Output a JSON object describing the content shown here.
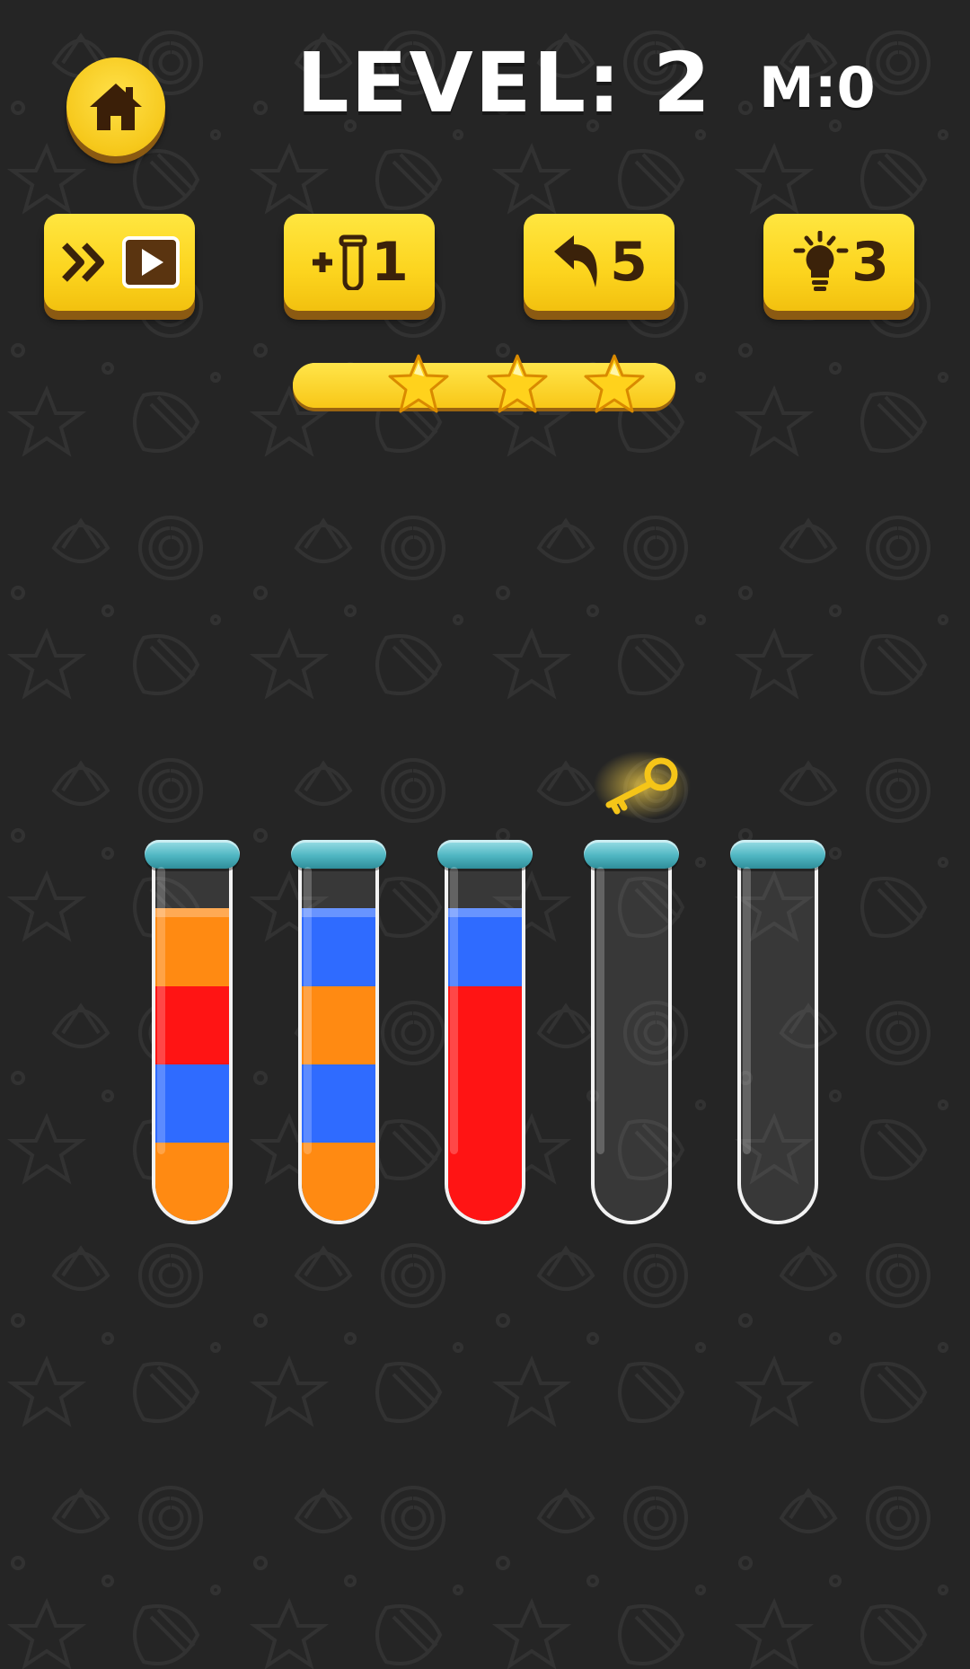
{
  "header": {
    "level_text": "LEVEL: 2",
    "moves_text": "M:0",
    "home_icon": "home-icon"
  },
  "powerups": [
    {
      "name": "skip-level",
      "icons": [
        "double-chevron-icon",
        "play-video-icon"
      ],
      "label": ""
    },
    {
      "name": "add-tube",
      "icons": [
        "plus-icon",
        "tube-icon"
      ],
      "label": "1"
    },
    {
      "name": "undo",
      "icons": [
        "undo-arrow-icon"
      ],
      "label": "5"
    },
    {
      "name": "hint",
      "icons": [
        "lightbulb-icon"
      ],
      "label": "3"
    }
  ],
  "stars": {
    "count": 3,
    "earned": 3
  },
  "key_icon": "key-icon",
  "colors": {
    "orange": "#ff8a12",
    "red": "#ff1414",
    "blue": "#2f6bff",
    "button_yellow": "#fcd41e",
    "button_dark": "#3b220a",
    "rim": "#4fb6c2"
  },
  "tubes": [
    {
      "capacity": 4,
      "layers_bottom_to_top": [
        "orange",
        "blue",
        "red",
        "orange"
      ]
    },
    {
      "capacity": 4,
      "layers_bottom_to_top": [
        "orange",
        "blue",
        "orange",
        "blue"
      ]
    },
    {
      "capacity": 4,
      "layers_bottom_to_top": [
        "red",
        "red",
        "red",
        "blue"
      ]
    },
    {
      "capacity": 4,
      "layers_bottom_to_top": []
    },
    {
      "capacity": 4,
      "layers_bottom_to_top": []
    }
  ]
}
